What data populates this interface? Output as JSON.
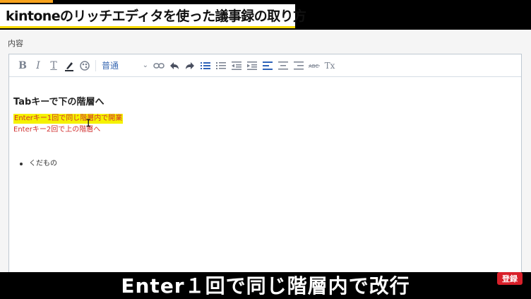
{
  "video": {
    "title": "kintoneのリッチエディタを使った議事録の取り方",
    "caption": "Enter１回で同じ階層内で改行",
    "subscribe_badge": "登録"
  },
  "form": {
    "field_label": "内容"
  },
  "toolbar": {
    "bold_icon": "B",
    "italic_icon": "I",
    "font_icon": "T",
    "style_select_value": "普通",
    "remove_format_icon": "Tx"
  },
  "document": {
    "heading": "Tabキーで下の階層へ",
    "line_highlighted": "Enterキー1回で同じ階層内で開業",
    "line_red": "Enterキー2回で上の階層へ",
    "bullet_item": "くだもの"
  },
  "colors": {
    "title_underline": "#f6d800",
    "highlight": "#f5f200",
    "red_text": "#d03030",
    "subscribe_red": "#d8202a"
  }
}
